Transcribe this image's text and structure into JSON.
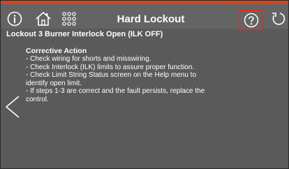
{
  "header": {
    "title": "Hard Lockout"
  },
  "lockout": {
    "title": "Lockout 3 Burner Interlock Open (ILK OFF)"
  },
  "corrective_action": {
    "heading": "Corrective Action",
    "lines": [
      "- Check wiring for shorts and misswiring.",
      "- Check Interlock (ILK) limits to assure proper function.",
      "- Check  Limit String Status screen on the Help menu to",
      "identify open limit.",
      "- If steps 1-3 are correct and the fault persists, replace the",
      "control."
    ]
  },
  "icons": {
    "info": "info-icon",
    "home": "home-icon",
    "menu": "grid-icon",
    "help": "help-icon",
    "back": "back-icon",
    "previous": "left-arrow-icon"
  },
  "colors": {
    "background": "#5a5a5a",
    "topbar": "#646464",
    "accent_stripe": "#d4451c",
    "help_highlight": "#d83323",
    "text": "#ffffff"
  }
}
